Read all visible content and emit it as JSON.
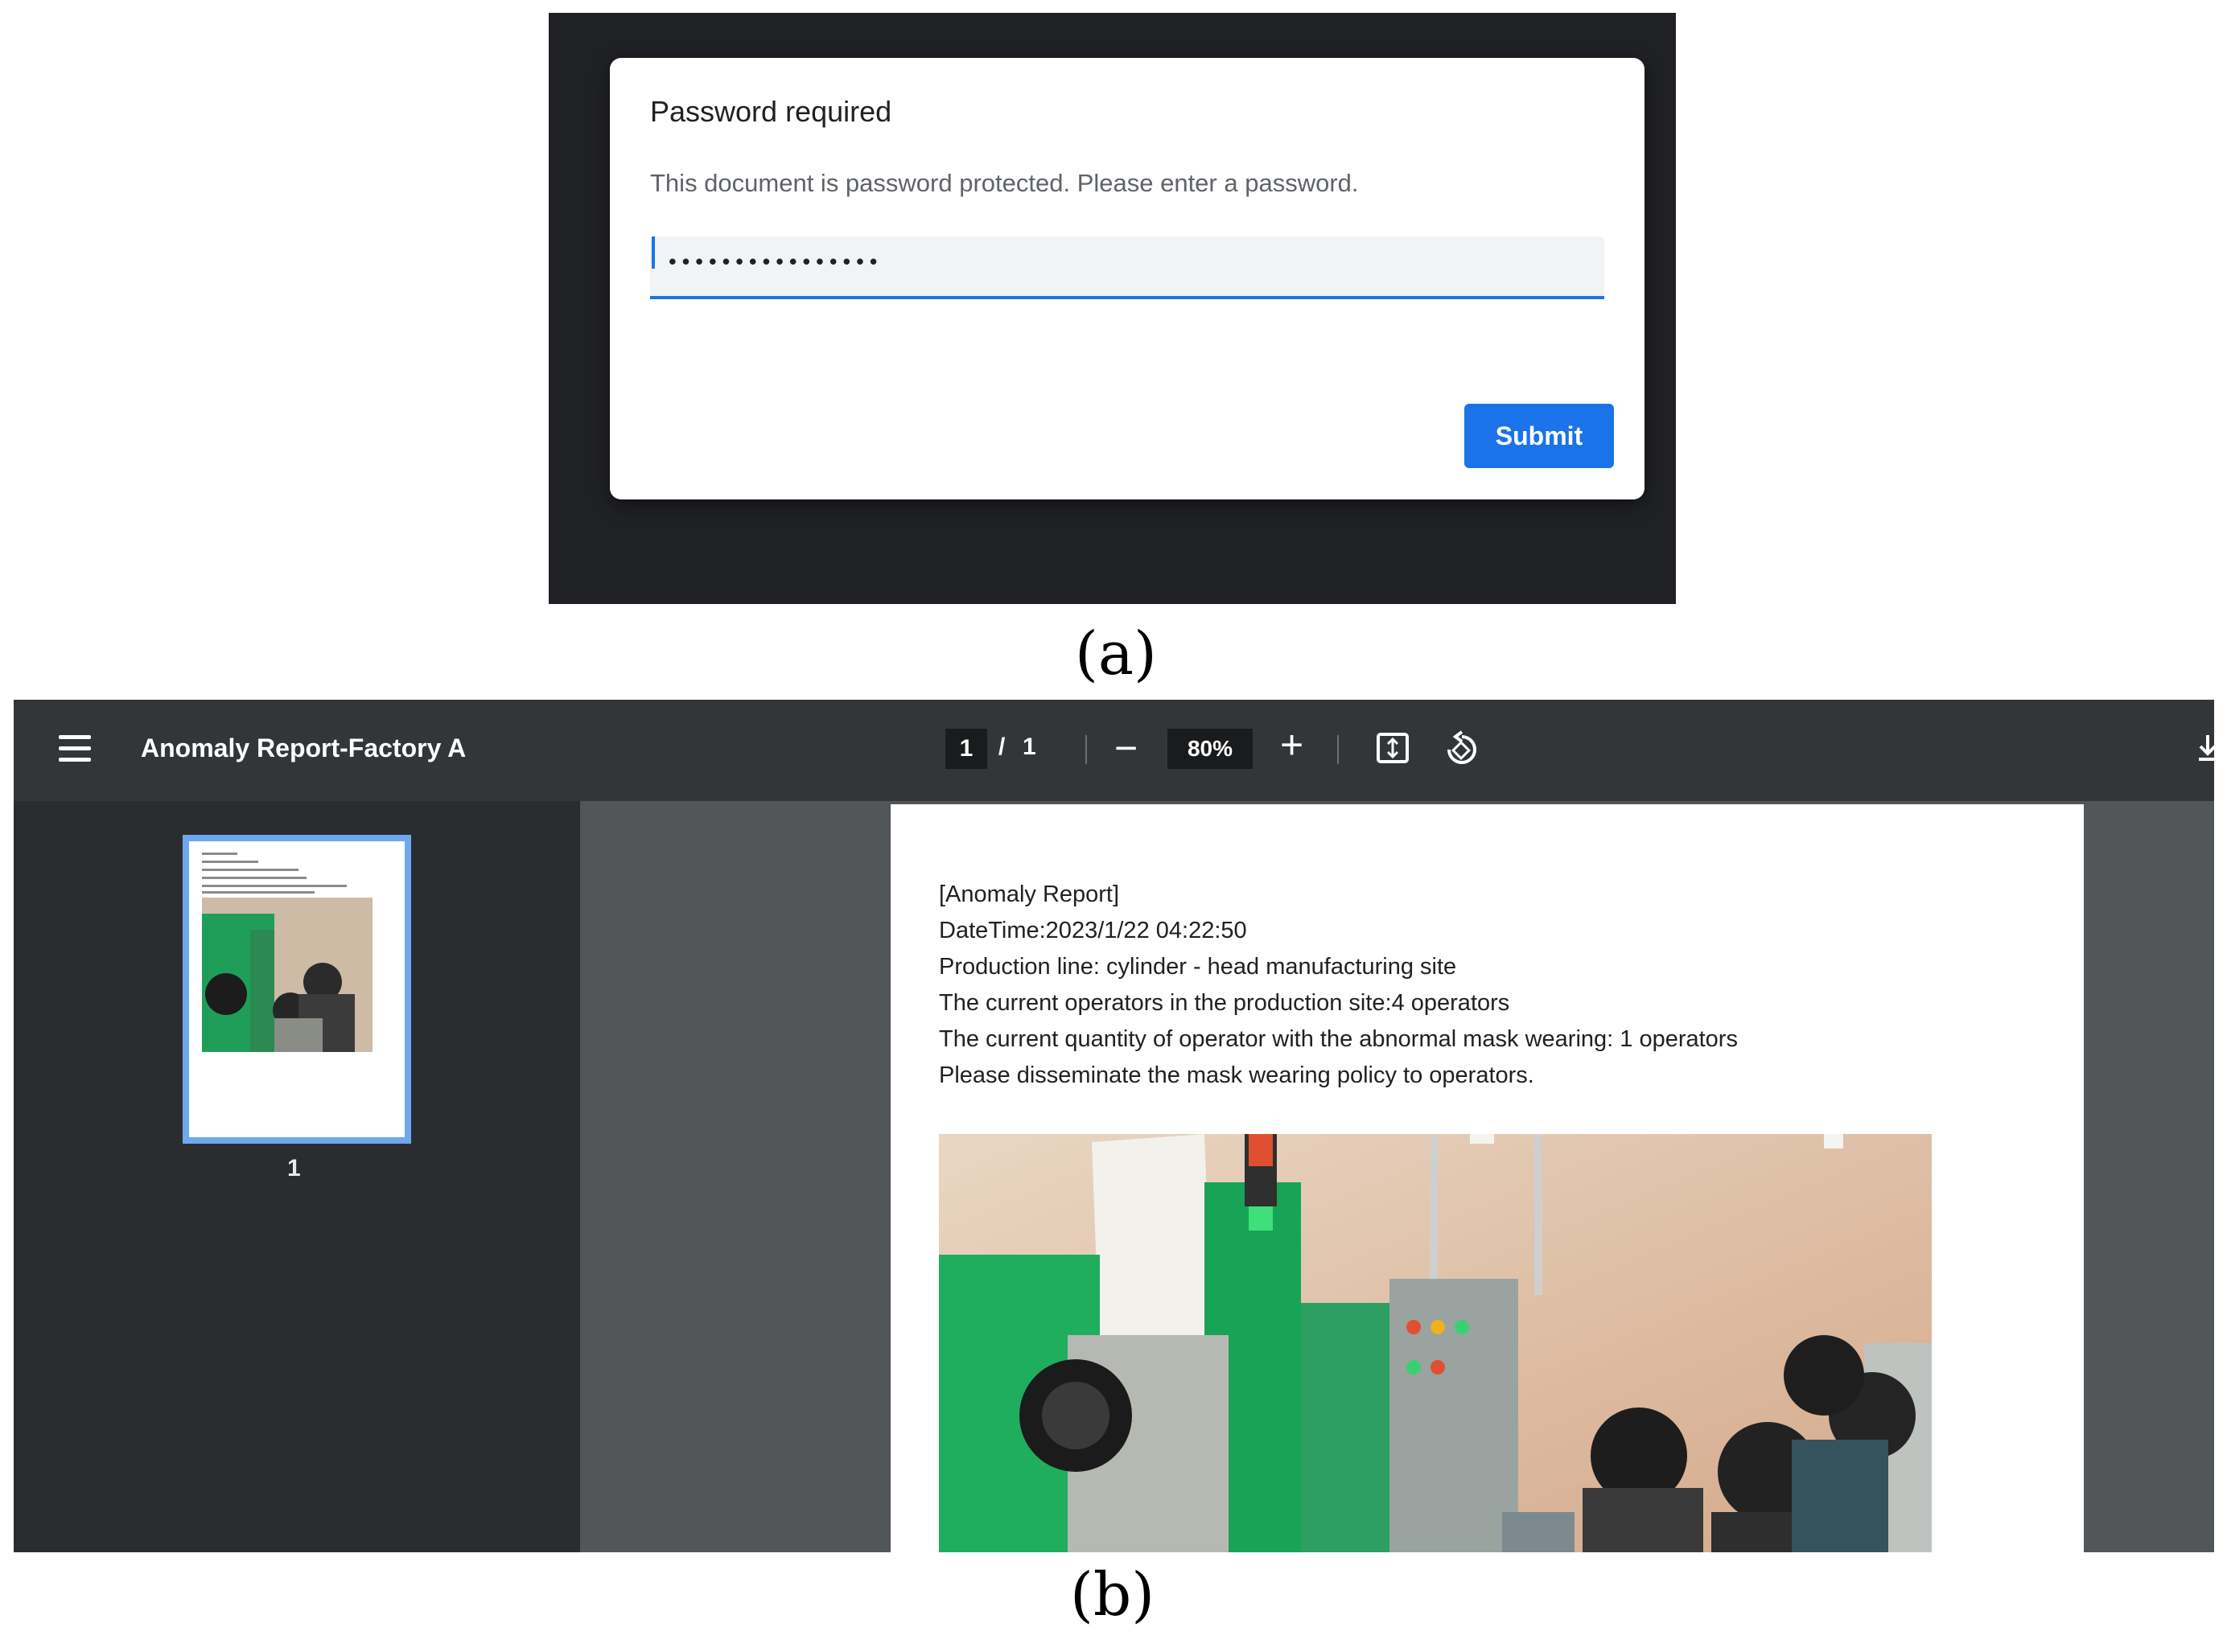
{
  "panel_a": {
    "caption": "(a)",
    "dialog": {
      "title": "Password required",
      "message": "This document is password protected. Please enter a password.",
      "password_mask": "••••••••••••••••",
      "submit_label": "Submit"
    },
    "colors": {
      "backdrop": "#202124",
      "accent": "#1a73e8"
    }
  },
  "panel_b": {
    "caption": "(b)",
    "toolbar": {
      "title": "Anomaly Report-Factory A",
      "current_page": "1",
      "page_separator": "/",
      "total_pages": "1",
      "zoom": "80%",
      "zoom_out_glyph": "−",
      "zoom_in_glyph": "+",
      "icons": [
        "menu-icon",
        "fit-page-icon",
        "rotate-icon",
        "download-icon"
      ]
    },
    "sidebar": {
      "thumbnail_label": "1"
    },
    "report": {
      "lines": [
        "[Anomaly Report]",
        "DateTime:2023/1/22  04:22:50",
        "Production line: cylinder - head manufacturing site",
        "The current operators in the production site:4 operators",
        "The current quantity of operator with the abnormal mask wearing: 1  operators",
        "Please disseminate the mask wearing policy to operators."
      ]
    },
    "colors": {
      "toolbar": "#323639",
      "sidebar": "#2a2d30",
      "viewer": "#525659",
      "thumb_border": "#6fa7f0"
    }
  }
}
